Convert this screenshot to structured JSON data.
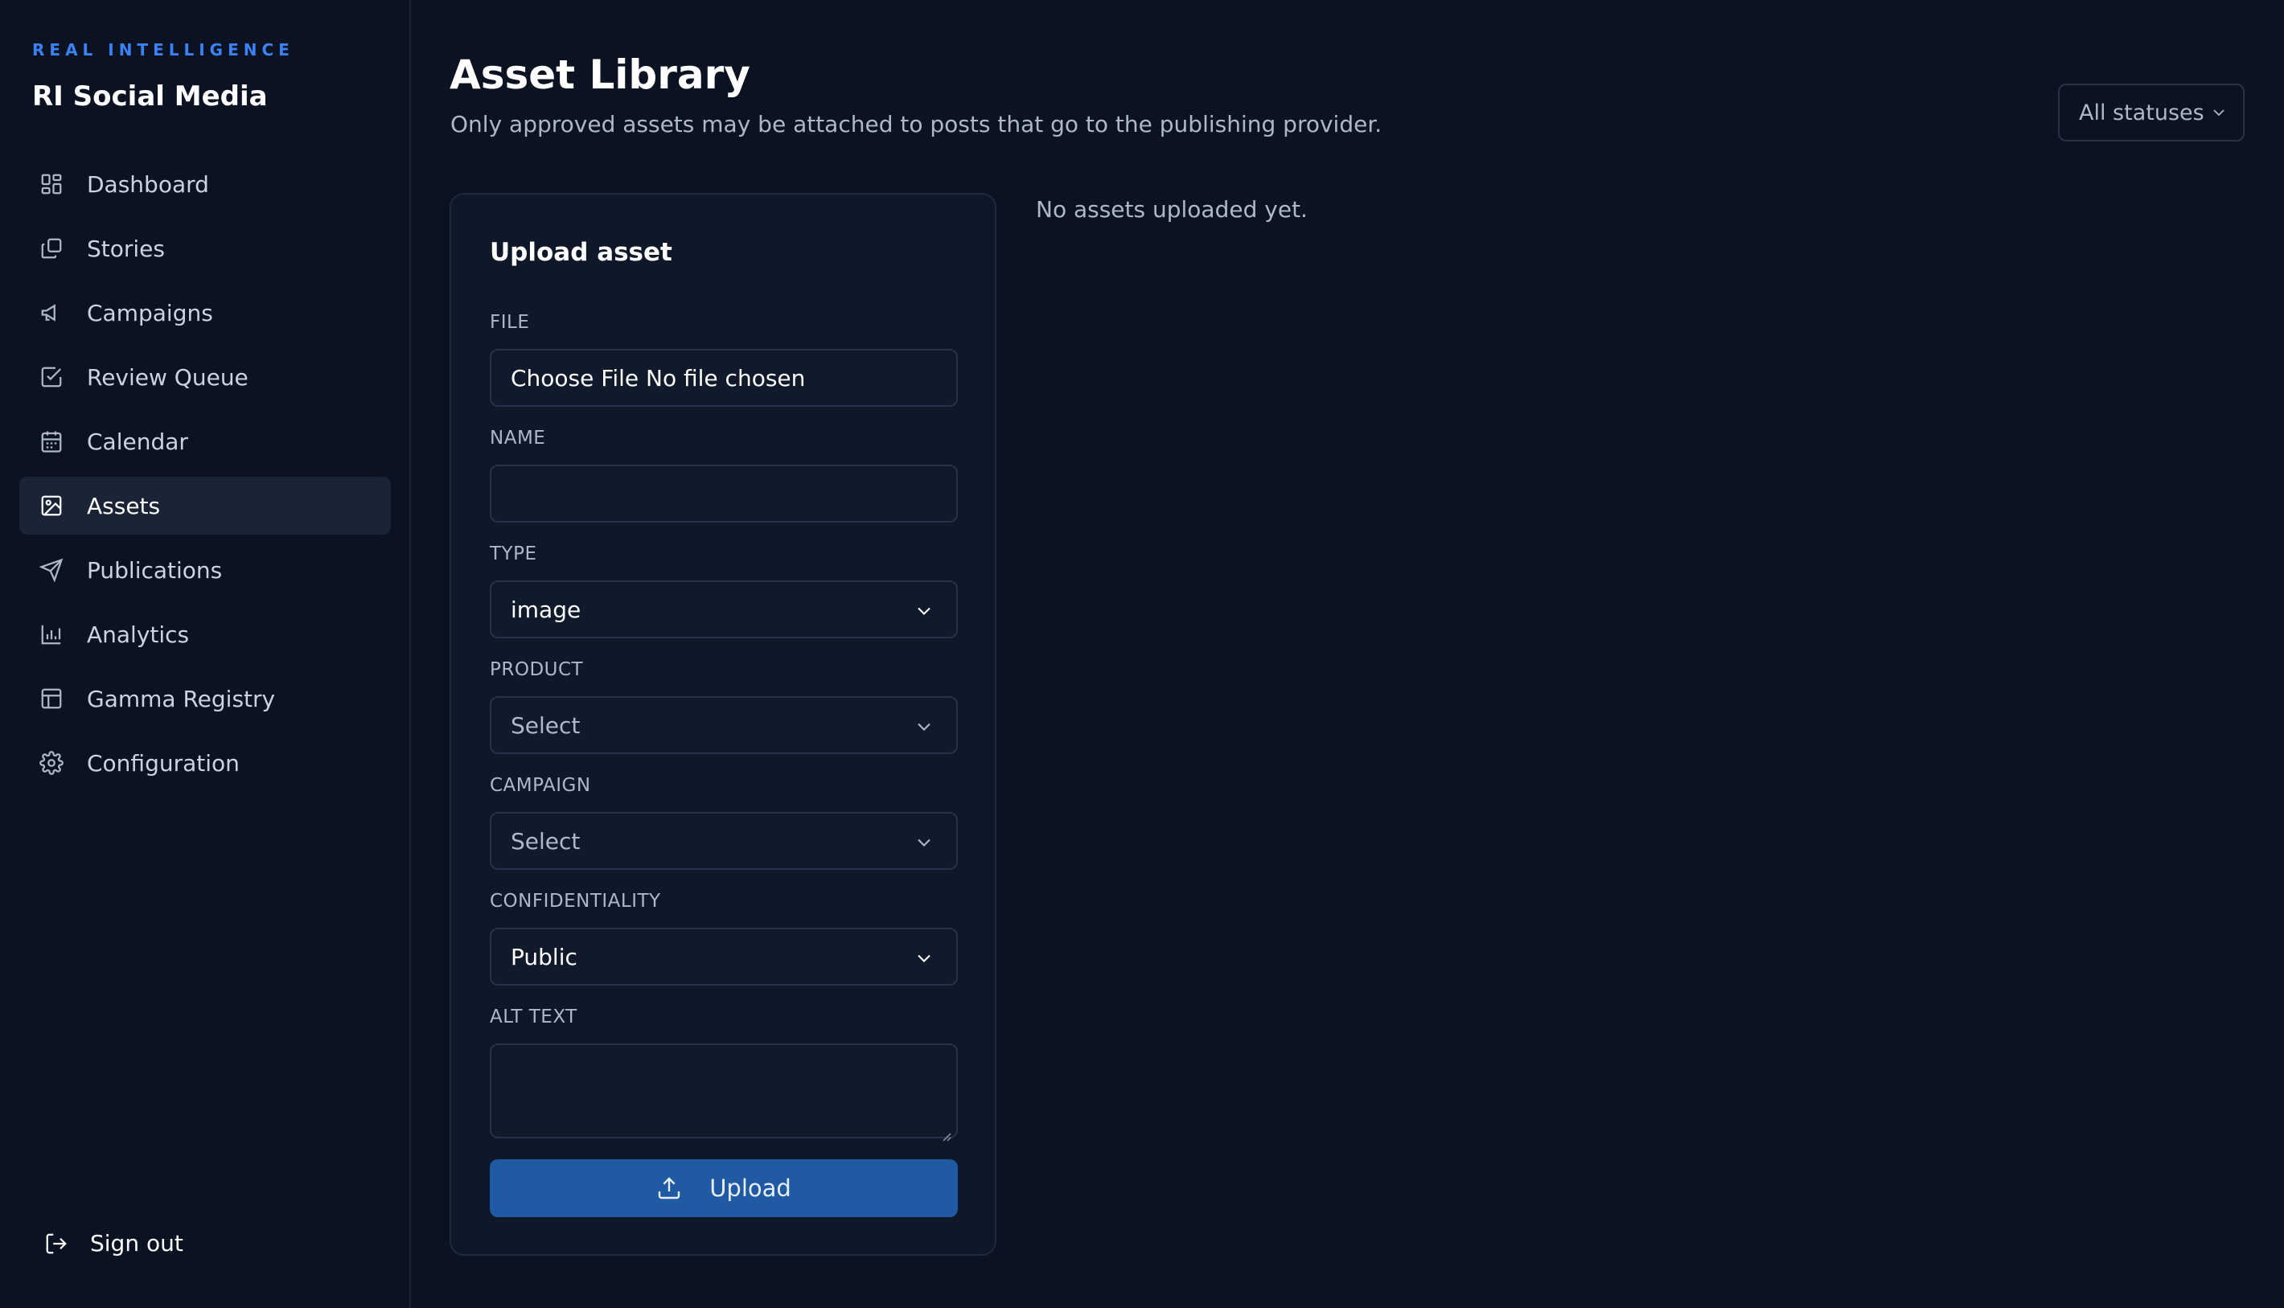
{
  "brand": {
    "kicker": "REAL INTELLIGENCE",
    "title": "RI Social Media"
  },
  "nav": {
    "items": [
      {
        "label": "Dashboard",
        "icon": "dashboard-grid-icon"
      },
      {
        "label": "Stories",
        "icon": "stories-copy-icon"
      },
      {
        "label": "Campaigns",
        "icon": "megaphone-icon"
      },
      {
        "label": "Review Queue",
        "icon": "checkbox-icon"
      },
      {
        "label": "Calendar",
        "icon": "calendar-icon"
      },
      {
        "label": "Assets",
        "icon": "image-icon",
        "active": true
      },
      {
        "label": "Publications",
        "icon": "send-icon"
      },
      {
        "label": "Analytics",
        "icon": "bar-chart-icon"
      },
      {
        "label": "Gamma Registry",
        "icon": "table-icon"
      },
      {
        "label": "Configuration",
        "icon": "gear-icon"
      }
    ],
    "signout": {
      "label": "Sign out",
      "icon": "logout-icon"
    }
  },
  "header": {
    "title": "Asset Library",
    "subtitle": "Only approved assets may be attached to posts that go to the publishing provider.",
    "status_filter": "All statuses"
  },
  "upload_form": {
    "title": "Upload asset",
    "file": {
      "label": "FILE",
      "value": "Choose File No file chosen"
    },
    "name": {
      "label": "NAME",
      "value": ""
    },
    "type": {
      "label": "TYPE",
      "value": "image"
    },
    "product": {
      "label": "PRODUCT",
      "value": "Select"
    },
    "campaign": {
      "label": "CAMPAIGN",
      "value": "Select"
    },
    "confidentiality": {
      "label": "CONFIDENTIALITY",
      "value": "Public"
    },
    "alt_text": {
      "label": "ALT TEXT",
      "value": ""
    },
    "submit_label": "Upload"
  },
  "assets": {
    "empty_message": "No assets uploaded yet."
  },
  "colors": {
    "background": "#0b1221",
    "accent": "#3b82f6",
    "button": "#1f5aa3"
  }
}
